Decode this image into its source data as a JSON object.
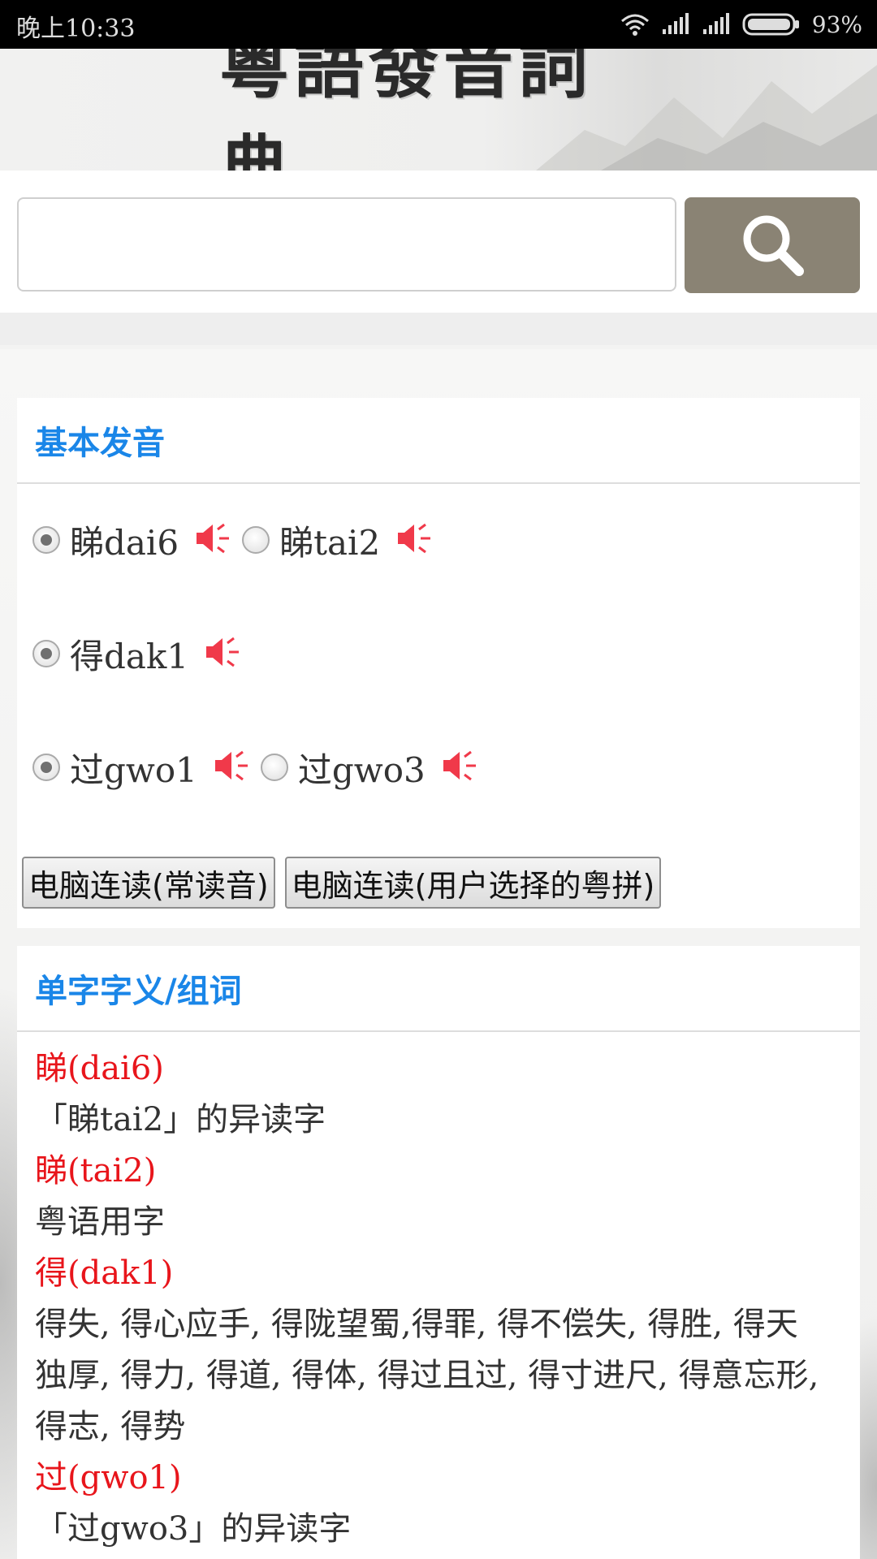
{
  "status_bar": {
    "time": "晚上10:33",
    "battery": "93%"
  },
  "header": {
    "title": "粵語發音詞典"
  },
  "search": {
    "value": "",
    "placeholder": ""
  },
  "pronunciation_card": {
    "title": "基本发音",
    "rows": [
      [
        {
          "label": "睇dai6",
          "checked": true
        },
        {
          "label": "睇tai2",
          "checked": false
        }
      ],
      [
        {
          "label": "得dak1",
          "checked": true
        }
      ],
      [
        {
          "label": "过gwo1",
          "checked": true
        },
        {
          "label": "过gwo3",
          "checked": false
        }
      ]
    ],
    "buttons": {
      "read_common": "电脑连读(常读音)",
      "read_selected": "电脑连读(用户选择的粤拼)"
    }
  },
  "meaning_card": {
    "title": "单字字义/组词",
    "lines": [
      {
        "text": "睇(dai6)",
        "type": "entry"
      },
      {
        "text": "「睇tai2」的异读字",
        "type": "text"
      },
      {
        "text": "睇(tai2)",
        "type": "entry"
      },
      {
        "text": "粤语用字",
        "type": "text"
      },
      {
        "text": "得(dak1)",
        "type": "entry"
      },
      {
        "text": "得失, 得心应手, 得陇望蜀,得罪, 得不偿失, 得胜, 得天",
        "type": "text"
      },
      {
        "text": "独厚, 得力, 得道, 得体, 得过且过, 得寸进尺, 得意忘形,",
        "type": "text"
      },
      {
        "text": "得志, 得势",
        "type": "text"
      },
      {
        "text": "过(gwo1)",
        "type": "entry"
      },
      {
        "text": "「过gwo3」的异读字",
        "type": "text"
      }
    ]
  },
  "colors": {
    "accent_blue": "#1a86e8",
    "entry_red": "#e8151b",
    "search_button": "#8a8374",
    "speaker_red": "#f0394a"
  },
  "icons": {
    "search": "search-icon",
    "speaker": "speaker-icon",
    "wifi": "wifi-icon",
    "signal": "signal-icon",
    "battery": "battery-icon"
  }
}
